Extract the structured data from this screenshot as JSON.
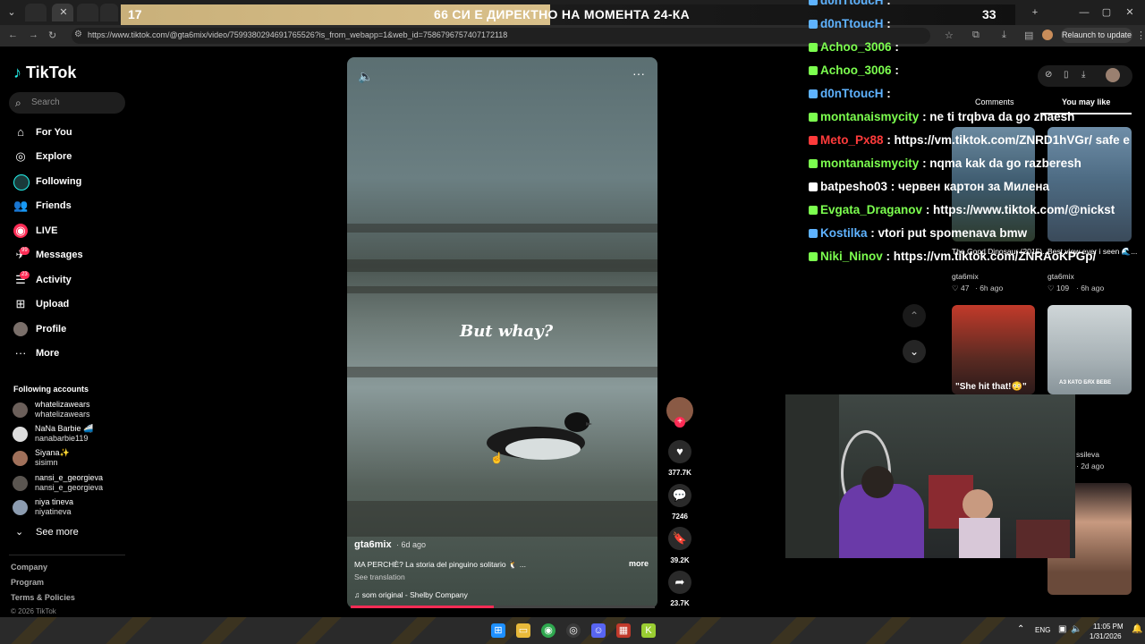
{
  "browser": {
    "url": "https://www.tiktok.com/@gta6mix/video/7599380294691765526?is_from_webapp=1&web_id=7586796757407172118",
    "relaunch_label": "Relaunch to update"
  },
  "stream_overlay": {
    "banner_number": "17",
    "banner_text": "66 СИ Е ДИРЕКТНО НА МОМЕНТА 24-КА",
    "banner_count": "33"
  },
  "sidebar": {
    "logo": "TikTok",
    "search_placeholder": "Search",
    "items": [
      {
        "label": "For You",
        "icon": "home-icon"
      },
      {
        "label": "Explore",
        "icon": "compass-icon"
      },
      {
        "label": "Following",
        "icon": "following-icon"
      },
      {
        "label": "Friends",
        "icon": "friends-icon"
      },
      {
        "label": "LIVE",
        "icon": "live-icon"
      },
      {
        "label": "Messages",
        "icon": "messages-icon",
        "badge": "99"
      },
      {
        "label": "Activity",
        "icon": "activity-icon",
        "badge": "23"
      },
      {
        "label": "Upload",
        "icon": "upload-icon"
      },
      {
        "label": "Profile",
        "icon": "profile-icon"
      },
      {
        "label": "More",
        "icon": "more-icon"
      }
    ],
    "following_header": "Following accounts",
    "accounts": [
      {
        "name": "whatelizawears",
        "handle": "whatelizawears"
      },
      {
        "name": "NaNa Barbie 🚄",
        "handle": "nanabarbie119"
      },
      {
        "name": "Siyana✨",
        "handle": "sisimn"
      },
      {
        "name": "nansi_e_georgieva",
        "handle": "nansi_e_georgieva"
      },
      {
        "name": "niya tineva",
        "handle": "niyatineva"
      }
    ],
    "see_more": "See more",
    "footer": [
      "Company",
      "Program",
      "Terms & Policies"
    ],
    "copyright": "© 2026 TikTok"
  },
  "video": {
    "overlay_caption": "But whay?",
    "author": "gta6mix",
    "age": "· 6d ago",
    "description": "MA PERCHÈ? La storia del pinguino solitario 🐧 ...",
    "more": "more",
    "see_translation": "See translation",
    "sound": "♫  som original - Shelby Company",
    "progress": 0.47
  },
  "actions": {
    "likes": "377.7K",
    "comments": "7246",
    "saves": "39.2K",
    "shares": "23.7K"
  },
  "chat": [
    {
      "user": "d0nTtoucH",
      "color": "#5fb3ff",
      "msg": ":"
    },
    {
      "user": "d0nTtoucH",
      "color": "#5fb3ff",
      "msg": ":"
    },
    {
      "user": "Achoo_3006",
      "color": "#7cff4f",
      "msg": ":"
    },
    {
      "user": "Achoo_3006",
      "color": "#7cff4f",
      "msg": ":"
    },
    {
      "user": "d0nTtoucH",
      "color": "#5fb3ff",
      "msg": ":"
    },
    {
      "user": "montanaismycity",
      "color": "#7cff4f",
      "msg": ": ne ti trqbva da go znaesh"
    },
    {
      "user": "Meto_Px88",
      "color": "#ff3b3b",
      "msg": ": https://vm.tiktok.com/ZNRD1hVGr/ safe e"
    },
    {
      "user": "montanaismycity",
      "color": "#7cff4f",
      "msg": ": nqma kak da go razberesh"
    },
    {
      "user": "batpesho03",
      "color": "#ffffff",
      "msg": ": червен картон за Милена"
    },
    {
      "user": "Evgata_Draganov",
      "color": "#7cff4f",
      "msg": ": https://www.tiktok.com/@nickst"
    },
    {
      "user": "Kostilka",
      "color": "#5fb3ff",
      "msg": ": vtori put spomenava bmw"
    },
    {
      "user": "Niki_Ninov",
      "color": "#7cff4f",
      "msg": ": https://vm.tiktok.com/ZNRAoKPGp/"
    }
  ],
  "right_panel": {
    "tab_comments": "Comments",
    "tab_like": "You may like",
    "thumbs": [
      {
        "title": "The Good Dinosaur (2015)...",
        "user": "gta6mix",
        "likes": "♡ 47",
        "age": "· 6h ago"
      },
      {
        "title": "Best view ever i seen 🌊...",
        "user": "gta6mix",
        "likes": "♡ 109",
        "age": "· 6h ago"
      },
      {
        "title": "\"She hit that!😳\"",
        "user": "",
        "likes": "",
        "age": ""
      },
      {
        "title": "АЗ КАТО БЯХ ВЕВЕ",
        "user": "ssileva",
        "likes": "",
        "age": "· 2d ago"
      }
    ]
  },
  "taskbar": {
    "lang": "ENG",
    "time": "11:05 PM",
    "date": "1/31/2026"
  },
  "colors": {
    "accent": "#fe2c55",
    "background": "#000000"
  }
}
